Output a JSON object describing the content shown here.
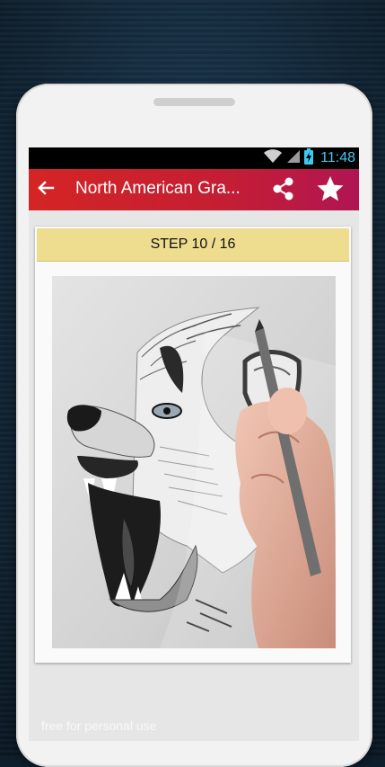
{
  "status_bar": {
    "time": "11:48",
    "icons": [
      "wifi-icon",
      "signal-icon",
      "battery-icon"
    ]
  },
  "app_bar": {
    "title": "North American Gra...",
    "back_icon": "arrow-left-icon",
    "share_icon": "share-icon",
    "favorite_icon": "star-icon"
  },
  "step": {
    "label": "STEP 10 / 16",
    "current": 10,
    "total": 16
  },
  "image": {
    "subject": "pencil drawing of a snarling wolf head in progress"
  },
  "watermark": "free for personal use",
  "colors": {
    "app_bar": "#c41e34",
    "step_header": "#eedc8f",
    "status_time": "#3dc8f1"
  }
}
